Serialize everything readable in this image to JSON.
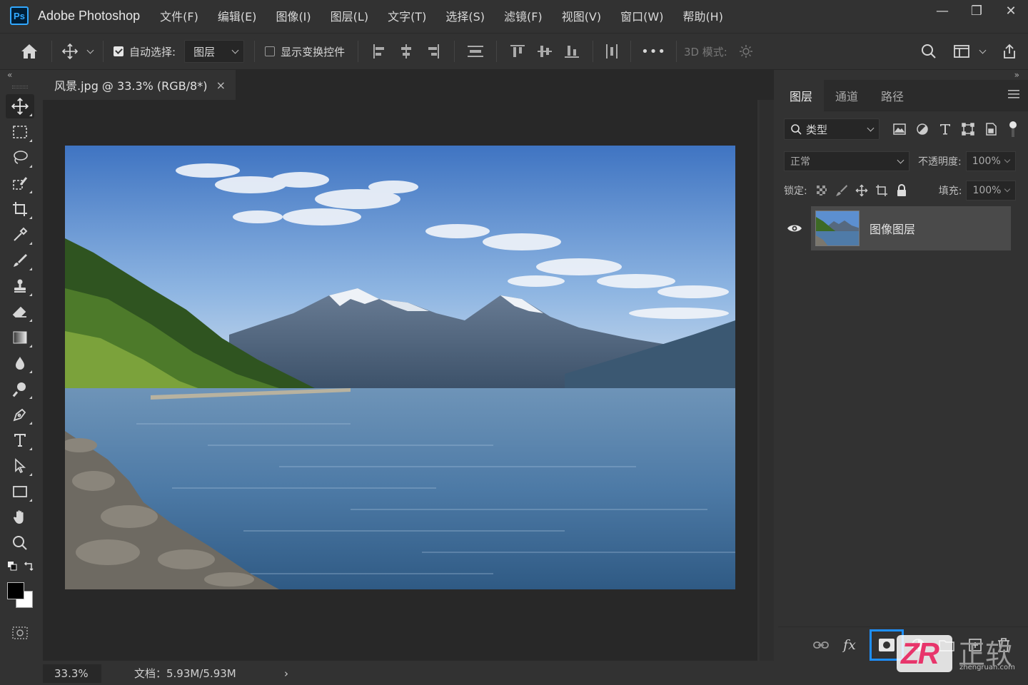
{
  "app": {
    "logo": "Ps",
    "title": "Adobe Photoshop"
  },
  "menu": [
    "文件(F)",
    "编辑(E)",
    "图像(I)",
    "图层(L)",
    "文字(T)",
    "选择(S)",
    "滤镜(F)",
    "视图(V)",
    "窗口(W)",
    "帮助(H)"
  ],
  "window_controls": {
    "minimize": "—",
    "restore": "❐",
    "close": "✕"
  },
  "options": {
    "auto_select_label": "自动选择:",
    "auto_select_checked": true,
    "auto_select_target": "图层",
    "show_transform_label": "显示变换控件",
    "show_transform_checked": false,
    "more": "•••",
    "mode_3d_label": "3D 模式:"
  },
  "panels": {
    "collapse_left": "«",
    "collapse_right": "»"
  },
  "document": {
    "tab_title": "风景.jpg @ 33.3% (RGB/8*)",
    "close_icon": "×",
    "zoom": "33.3%",
    "doc_info": "文档：5.93M/5.93M",
    "status_arrow": "›"
  },
  "layers_panel": {
    "tabs": [
      "图层",
      "通道",
      "路径"
    ],
    "active_tab": 0,
    "filter_kind": "类型",
    "blend_mode": "正常",
    "opacity_label": "不透明度:",
    "opacity_value": "100%",
    "lock_label": "锁定:",
    "fill_label": "填充:",
    "fill_value": "100%",
    "layers": [
      {
        "name": "图像图层",
        "visible": true
      }
    ],
    "bottom_icons": [
      "link-icon",
      "fx-icon",
      "add-mask-icon",
      "adjustment-icon",
      "group-icon",
      "new-layer-icon",
      "trash-icon"
    ],
    "fx_label": "fx"
  },
  "watermark": {
    "logo": "ZR",
    "name": "正软",
    "site": "zhengruan.com"
  },
  "colors": {
    "accent": "#31a8ff",
    "highlight": "#1e90ff",
    "bg": "#323232",
    "canvas_bg": "#282828"
  }
}
